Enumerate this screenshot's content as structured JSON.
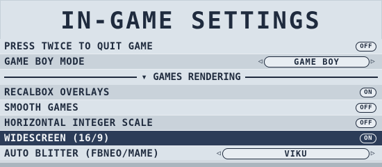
{
  "title": "IN-GAME SETTINGS",
  "rows_top": [
    {
      "label": "PRESS TWICE TO QUIT GAME",
      "switch": "OFF"
    }
  ],
  "gameboy_mode": {
    "label": "GAME BOY MODE",
    "value": "GAME BOY"
  },
  "section": {
    "label": "GAMES RENDERING"
  },
  "rendering_rows": [
    {
      "label": "RECALBOX OVERLAYS",
      "switch": "ON"
    },
    {
      "label": "SMOOTH GAMES",
      "switch": "OFF"
    },
    {
      "label": "HORIZONTAL INTEGER SCALE",
      "switch": "OFF"
    },
    {
      "label": "WIDESCREEN (16/9)",
      "switch": "ON"
    }
  ],
  "auto_blitter": {
    "label": "AUTO BLITTER (FBNEO/MAME)",
    "value": "VIKU"
  },
  "colors": {
    "accent_dark": "#1f2b3e",
    "selected_bg": "#2c3c58",
    "panel": "#dbe3ea"
  }
}
